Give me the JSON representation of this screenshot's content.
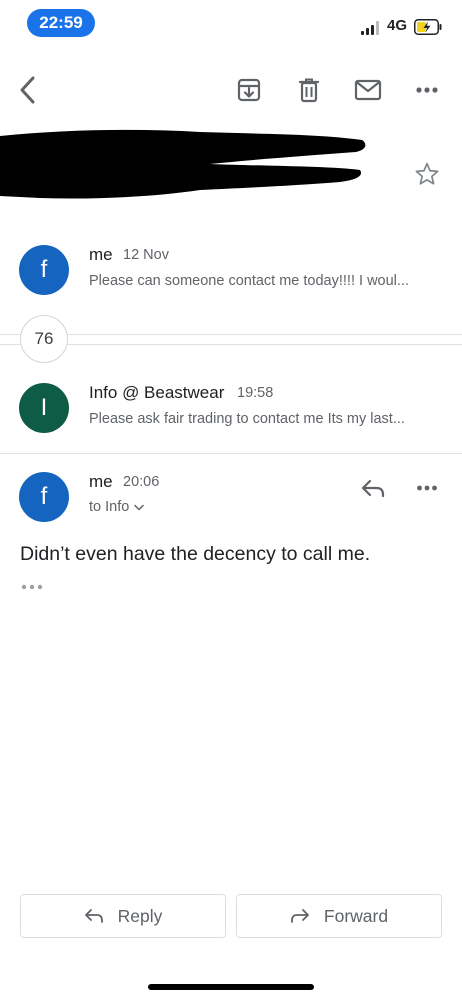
{
  "status_bar": {
    "time": "22:59",
    "network": "4G"
  },
  "colors": {
    "accent": "#1a73e8",
    "avatar_me": "#1565c0",
    "avatar_info": "#0f5c46",
    "text_secondary": "#5f6368",
    "icon_gray": "#5f6368"
  },
  "toolbar": {
    "back_icon": "chevron-left-icon",
    "archive_icon": "archive-icon",
    "delete_icon": "trash-icon",
    "mark_unread_icon": "mail-icon",
    "more_icon": "more-horizontal-icon"
  },
  "thread": {
    "subject_redacted": true,
    "collapsed_count": "76",
    "messages": [
      {
        "avatar_letter": "f",
        "sender": "me",
        "date": "12 Nov",
        "snippet": "Please can someone contact me today!!!! I woul..."
      },
      {
        "avatar_letter": "I",
        "sender": "Info @ Beastwear",
        "date": "19:58",
        "snippet": "Please ask fair trading to contact me Its my last..."
      }
    ],
    "expanded": {
      "avatar_letter": "f",
      "sender": "me",
      "date": "20:06",
      "to": "to Info",
      "body": "Didn’t even have the decency to call me."
    }
  },
  "actions": {
    "reply_label": "Reply",
    "forward_label": "Forward"
  }
}
